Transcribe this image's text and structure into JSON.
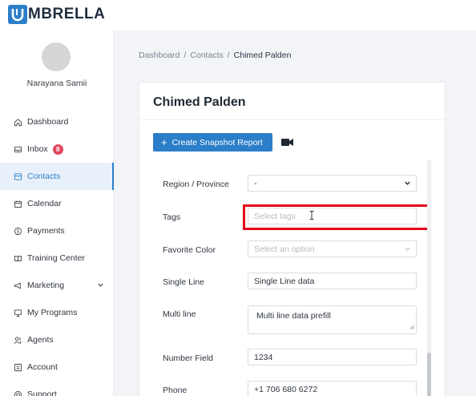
{
  "app": {
    "logo_text": "MBRELLA",
    "logo_letter_icon": "umbrella-u-icon"
  },
  "user": {
    "name": "Narayana Samii"
  },
  "sidebar": {
    "items": [
      {
        "label": "Dashboard",
        "icon": "home-icon"
      },
      {
        "label": "Inbox",
        "icon": "inbox-icon",
        "badge": "8"
      },
      {
        "label": "Contacts",
        "icon": "contacts-icon",
        "active": true
      },
      {
        "label": "Calendar",
        "icon": "calendar-icon"
      },
      {
        "label": "Payments",
        "icon": "dollar-icon"
      },
      {
        "label": "Training Center",
        "icon": "book-icon"
      },
      {
        "label": "Marketing",
        "icon": "megaphone-icon",
        "expandable": true
      },
      {
        "label": "My Programs",
        "icon": "monitor-icon"
      },
      {
        "label": "Agents",
        "icon": "agents-icon"
      },
      {
        "label": "Account",
        "icon": "account-icon"
      },
      {
        "label": "Support",
        "icon": "support-icon"
      }
    ]
  },
  "breadcrumb": {
    "items": [
      "Dashboard",
      "Contacts"
    ],
    "separator": "/",
    "current": "Chimed Palden"
  },
  "page": {
    "title": "Chimed Palden"
  },
  "actions": {
    "snapshot_plus": "+",
    "snapshot_label": "Create Snapshot Report",
    "video_icon": "video-camera-icon"
  },
  "form": {
    "region": {
      "label": "Region / Province",
      "value": "-"
    },
    "tags": {
      "label": "Tags",
      "placeholder": "Select tags"
    },
    "favorite_color": {
      "label": "Favorite Color",
      "placeholder": "Select an option"
    },
    "single_line": {
      "label": "Single Line",
      "value": "Single Line data"
    },
    "multi_line": {
      "label": "Multi line",
      "value": "Multi line data prefill"
    },
    "number_field": {
      "label": "Number Field",
      "value": "1234"
    },
    "phone": {
      "label": "Phone",
      "value": "+1 706 680 6272"
    }
  },
  "colors": {
    "accent": "#2b7ec8",
    "badge": "#e0475f",
    "highlight": "#e3001b"
  }
}
